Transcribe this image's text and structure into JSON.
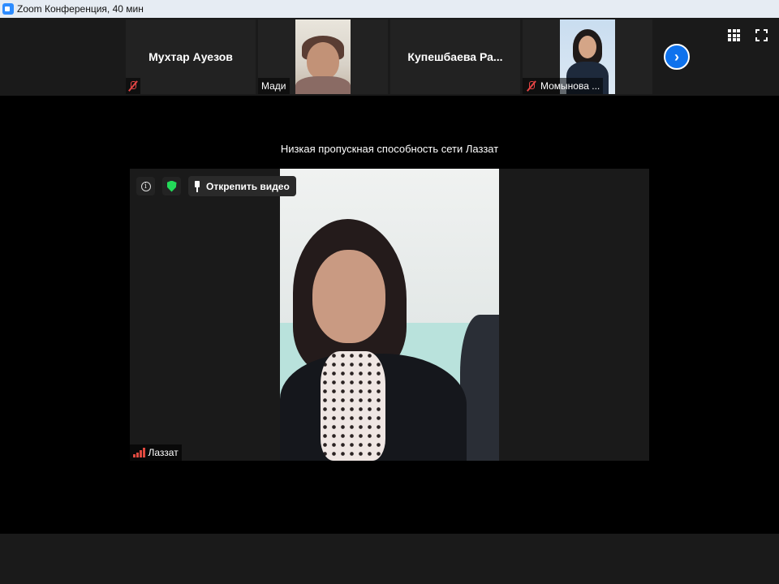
{
  "window": {
    "title": "Zoom Конференция, 40 мин"
  },
  "participants_strip": {
    "tiles": [
      {
        "name": "Мухтар Ауезов",
        "muted": true,
        "has_video": false
      },
      {
        "name": "Мади",
        "muted": false,
        "has_video": true
      },
      {
        "name": "Купешбаева  Ра...",
        "muted": false,
        "has_video": false
      },
      {
        "name": "Момынова ...",
        "muted": true,
        "has_video": true
      }
    ],
    "next_icon": "chevron-right-icon"
  },
  "view_controls": {
    "gallery_icon": "grid-icon",
    "fullscreen_icon": "fullscreen-icon"
  },
  "main": {
    "bandwidth_notice": "Низкая пропускная способность сети Лаззат",
    "speaker_name": "Лаззат",
    "info_tooltip_glyph": "i",
    "unpin_label": "Открепить видео",
    "security_color": "#23d959",
    "signal_color": "#e0493f"
  },
  "colors": {
    "accent": "#0e72ed",
    "mute": "#e64545"
  }
}
